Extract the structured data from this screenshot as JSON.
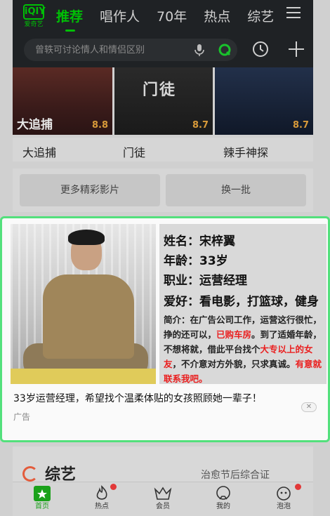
{
  "header": {
    "logo_text": "爱奇艺",
    "logo_mark": "iQIY",
    "tabs": [
      "推荐",
      "唱作人",
      "70年",
      "热点",
      "综艺"
    ],
    "active_tab": 0,
    "search_placeholder": "曾轶可讨论情人和情侣区别",
    "icons": [
      "mic-icon",
      "scan-icon",
      "history-icon",
      "plus-icon",
      "menu-icon"
    ]
  },
  "movies": {
    "items": [
      {
        "title": "大追捕",
        "score": "8.8",
        "poster_text": "大追捕"
      },
      {
        "title": "门徒",
        "score": "8.7",
        "poster_text": "门徒"
      },
      {
        "title": "辣手神探",
        "score": "8.7",
        "poster_text": ""
      }
    ],
    "more_button": "更多精彩影片",
    "refresh_button": "换一批"
  },
  "ad": {
    "name_line": "姓名：宋梓翼",
    "age_line": "年龄：33岁",
    "job_line": "职业：运营经理",
    "hobby_line": "爱好：看电影，打篮球，健身",
    "desc_part1": "简介：在广告公司工作，运营这行很忙，挣的还可以，",
    "desc_red1": "已购车房",
    "desc_part2": "。到了适婚年龄，不想将就，借此平台找个",
    "desc_red2": "大专以上的女友",
    "desc_part3": "，不介意对方外貌，只求真诚。",
    "desc_red3": "有意就联系我吧。",
    "caption": "33岁运营经理，希望找个温柔体贴的女孩照顾她一辈子！",
    "tag": "广告",
    "close": "✕",
    "border_color": "#53e07c"
  },
  "section": {
    "title": "综艺",
    "more": "治愈节后综合证"
  },
  "bottom_nav": {
    "items": [
      "首页",
      "热点",
      "会员",
      "我的",
      "泡泡"
    ],
    "active": 0,
    "accent": "#1aa11a"
  }
}
